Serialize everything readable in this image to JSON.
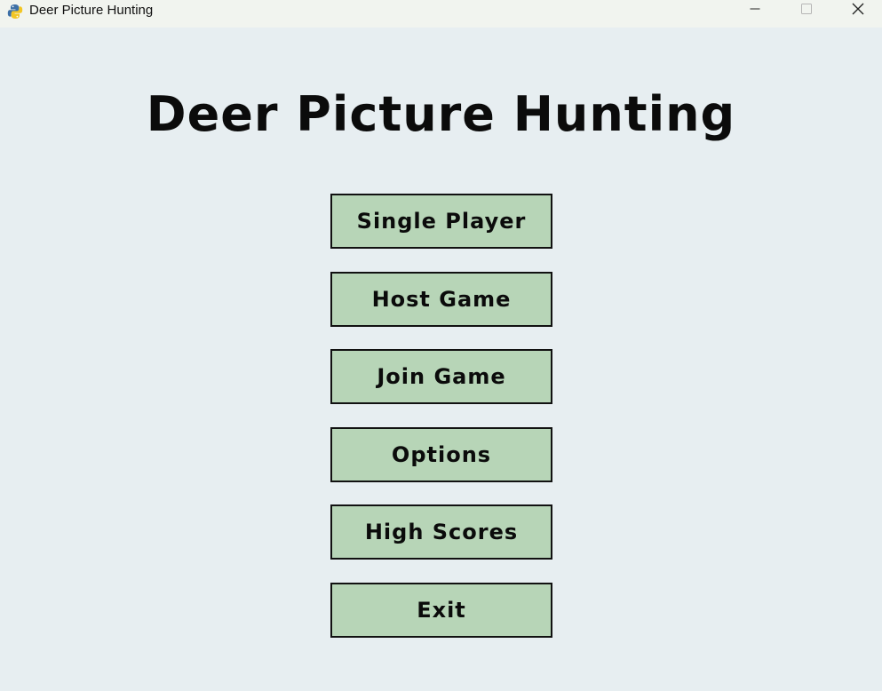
{
  "window": {
    "title": "Deer Picture Hunting",
    "icon": "python-icon",
    "controls": [
      "minimize-icon",
      "maximize-icon",
      "close-icon"
    ]
  },
  "game": {
    "title": "Deer Picture Hunting"
  },
  "menu": {
    "items": [
      {
        "label": "Single Player"
      },
      {
        "label": "Host Game"
      },
      {
        "label": "Join Game"
      },
      {
        "label": "Options"
      },
      {
        "label": "High Scores"
      },
      {
        "label": "Exit"
      }
    ]
  },
  "colors": {
    "background": "#e7eef1",
    "button_fill": "#b7d5b7",
    "button_border": "#111111",
    "text": "#0b0b0b"
  }
}
